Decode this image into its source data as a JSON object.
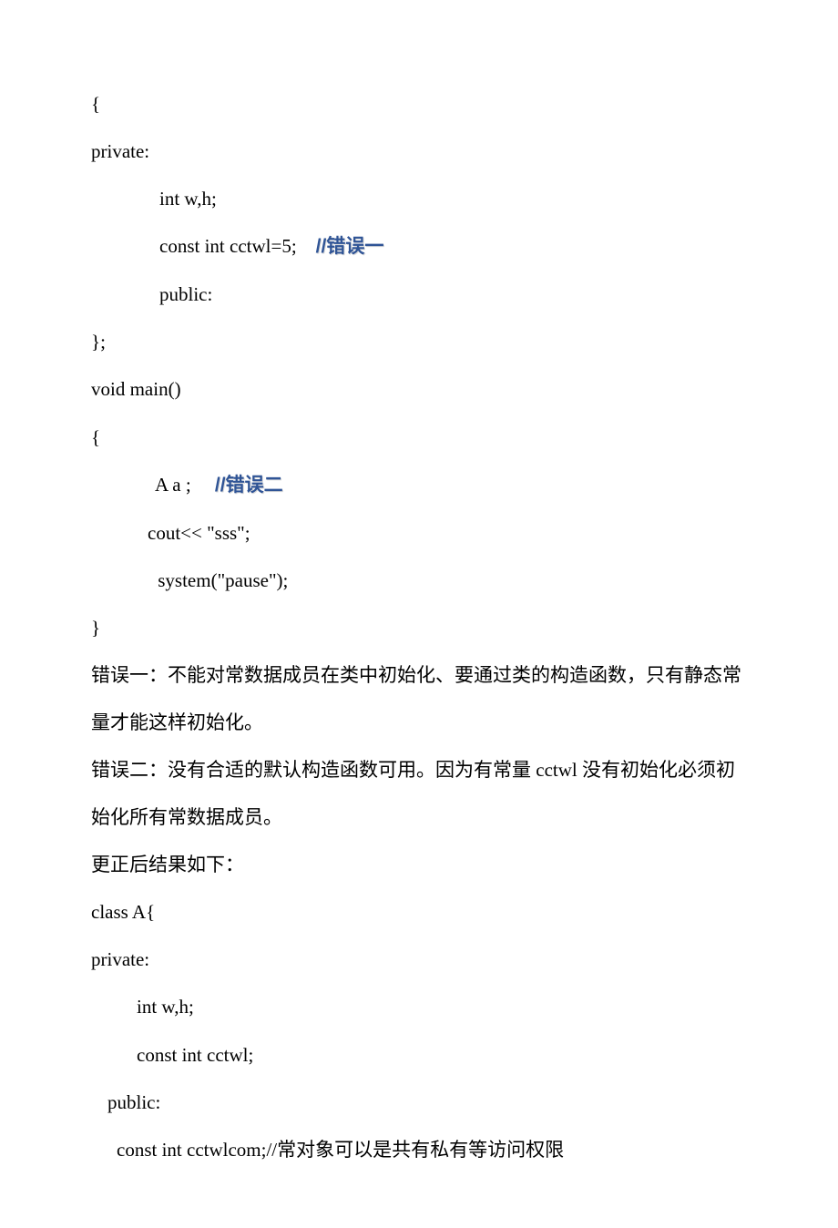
{
  "lines": {
    "l1": "{",
    "l2": "private:",
    "l3": "int w,h;",
    "l4a": "const int cctwl=5;    ",
    "l4b": "//错误一",
    "l5": "public:",
    "l6": "};",
    "l7": "void main()",
    "l8": "{",
    "l9a": "A a ;     ",
    "l9b": "//错误二",
    "l10": "cout<< \"sss\";",
    "l11": " system(\"pause\");",
    "l12": "}",
    "l13": "错误一：不能对常数据成员在类中初始化、要通过类的构造函数，只有静态常量才能这样初始化。",
    "l14": "错误二：没有合适的默认构造函数可用。因为有常量 cctwl 没有初始化必须初始化所有常数据成员。",
    "l15": "更正后结果如下：",
    "l16": "class A{",
    "l17": "private:",
    "l18": "int w,h;",
    "l19": "const int cctwl;",
    "l20": "public:",
    "l21": "const int cctwlcom;//常对象可以是共有私有等访问权限"
  }
}
